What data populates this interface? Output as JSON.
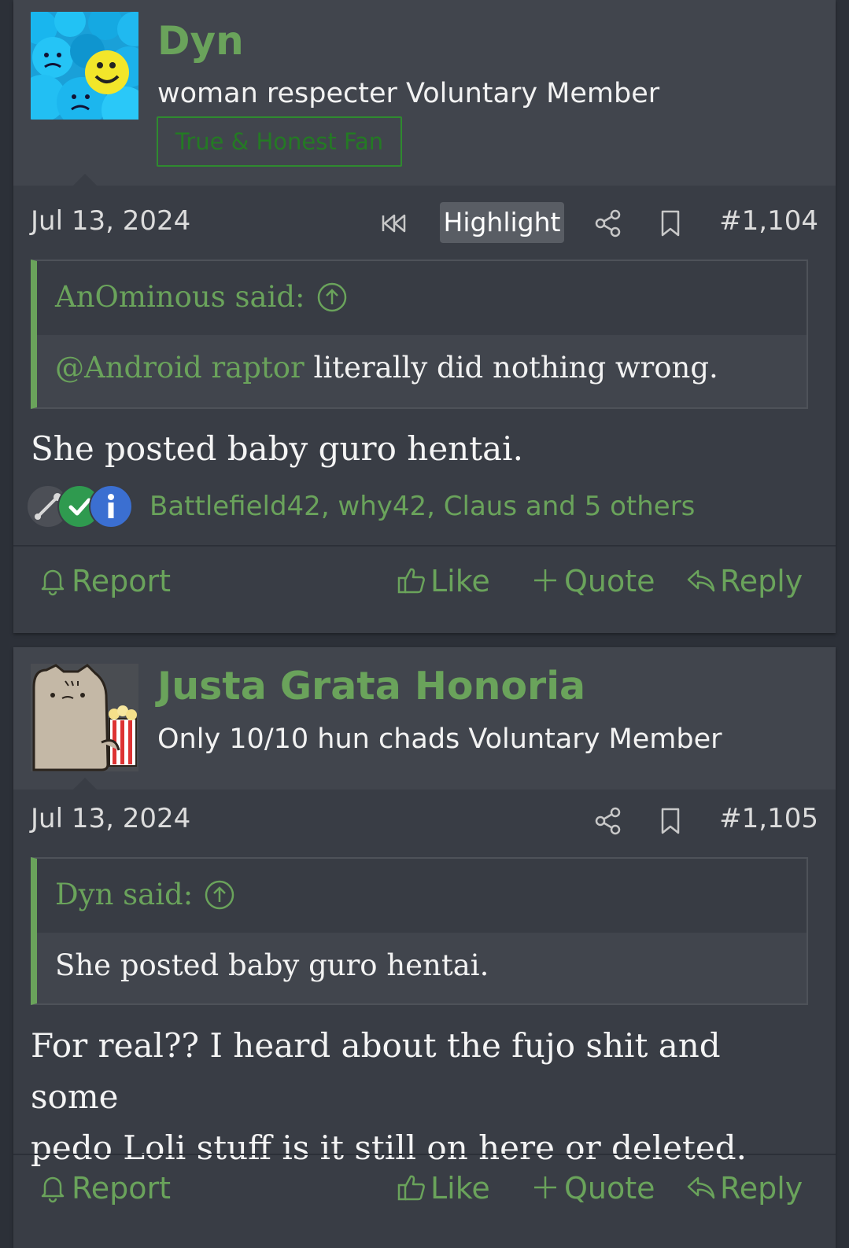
{
  "posts": [
    {
      "user": {
        "name": "Dyn",
        "title": "woman respecter Voluntary Member",
        "banner": "True & Honest Fan"
      },
      "date": "Jul 13, 2024",
      "highlight_label": "Highlight",
      "number": "#1,104",
      "quote": {
        "attribution": "AnOminous said:",
        "mention": "@Android raptor",
        "text": " literally did nothing wrong."
      },
      "body": "She posted baby guro hentai.",
      "reactions": {
        "users": "Battlefield42, why42, Claus and 5 others"
      },
      "actions": {
        "report": "Report",
        "like": "Like",
        "quote": "Quote",
        "reply": "Reply"
      }
    },
    {
      "user": {
        "name": "Justa Grata Honoria",
        "title": "Only 10/10 hun chads Voluntary Member"
      },
      "date": "Jul 13, 2024",
      "number": "#1,105",
      "quote": {
        "attribution": "Dyn said:",
        "text": "She posted baby guro hentai."
      },
      "body_lines": [
        "For real?? I heard about the fujo shit and some",
        "pedo Loli stuff is it still on here or deleted."
      ],
      "actions": {
        "report": "Report",
        "like": "Like",
        "quote": "Quote",
        "reply": "Reply"
      }
    }
  ],
  "colors": {
    "accent_green": "#6aa35b",
    "banner_green": "#247a24",
    "post_bg": "#393d45",
    "header_bg": "#41454d",
    "page_bg": "#2c3038"
  },
  "icons": [
    "rewind-icon",
    "share-icon",
    "bookmark-icon",
    "arrow-up-circle-icon",
    "bell-icon",
    "thumbs-up-icon",
    "plus-icon",
    "reply-arrow-icon",
    "wrench-icon",
    "check-icon",
    "info-icon"
  ]
}
